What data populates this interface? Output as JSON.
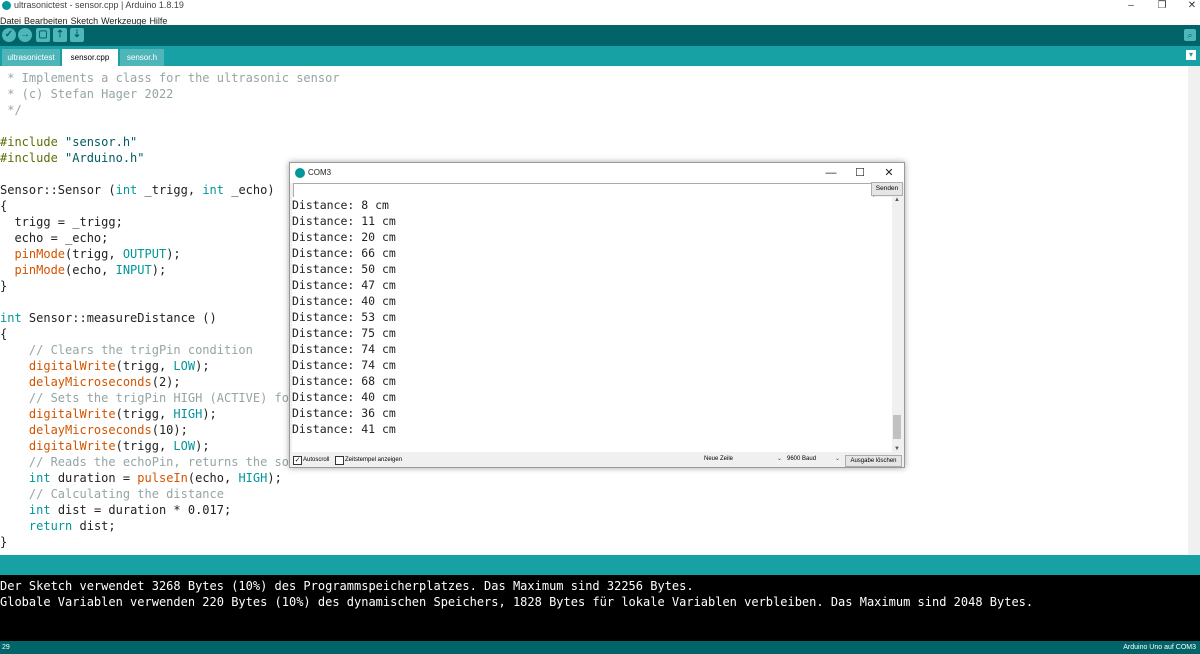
{
  "window": {
    "title": "ultrasonictest - sensor.cpp | Arduino 1.8.19",
    "minimize": "‒",
    "maximize": "❐",
    "close": "✕"
  },
  "menu": [
    "Datei",
    "Bearbeiten",
    "Sketch",
    "Werkzeuge",
    "Hilfe"
  ],
  "toolbar": {
    "verify": "✓",
    "upload": "→",
    "new": "▢",
    "open": "⇡",
    "save": "⇣",
    "serial_monitor": "⌕"
  },
  "tabs": [
    "ultrasonictest",
    "sensor.cpp",
    "sensor.h"
  ],
  "tab_menu": "▾",
  "editor": {
    "lines": [
      " * Implements a class for the ultrasonic sensor",
      " * (c) Stefan Hager 2022",
      " */",
      "",
      "#include \"sensor.h\"",
      "#include \"Arduino.h\"",
      "",
      "Sensor::Sensor (int _trigg, int _echo)",
      "{",
      "  trigg = _trigg;",
      "  echo = _echo;",
      "  pinMode(trigg, OUTPUT);",
      "  pinMode(echo, INPUT);",
      "}",
      "",
      "int Sensor::measureDistance ()",
      "{",
      "    // Clears the trigPin condition",
      "    digitalWrite(trigg, LOW);",
      "    delayMicroseconds(2);",
      "    // Sets the trigPin HIGH (ACTIVE) fo",
      "    digitalWrite(trigg, HIGH);",
      "    delayMicroseconds(10);",
      "    digitalWrite(trigg, LOW);",
      "    // Reads the echoPin, returns the so",
      "    int duration = pulseIn(echo, HIGH);",
      "    // Calculating the distance",
      "    int dist = duration * 0.017;",
      "    return dist;",
      "}"
    ]
  },
  "console": {
    "lines": [
      "Der Sketch verwendet 3268 Bytes (10%) des Programmspeicherplatzes. Das Maximum sind 32256 Bytes.",
      "Globale Variablen verwenden 220 Bytes (10%) des dynamischen Speichers, 1828 Bytes für lokale Variablen verbleiben. Das Maximum sind 2048 Bytes."
    ]
  },
  "footer": {
    "line_number": "29",
    "board": "Arduino Uno auf COM3"
  },
  "serial_monitor": {
    "title": "COM3",
    "minimize": "—",
    "maximize": "☐",
    "close": "✕",
    "input_value": "",
    "send_label": "Senden",
    "output": [
      "Distance: 8 cm",
      "Distance: 11 cm",
      "Distance: 20 cm",
      "Distance: 66 cm",
      "Distance: 50 cm",
      "Distance: 47 cm",
      "Distance: 40 cm",
      "Distance: 53 cm",
      "Distance: 75 cm",
      "Distance: 74 cm",
      "Distance: 74 cm",
      "Distance: 68 cm",
      "Distance: 40 cm",
      "Distance: 36 cm",
      "Distance: 41 cm"
    ],
    "autoscroll_label": "Autoscroll",
    "autoscroll_checked": true,
    "timestamp_label": "Zeitstempel anzeigen",
    "timestamp_checked": false,
    "line_ending": "Neue Zeile",
    "baud": "9600 Baud",
    "clear_label": "Ausgabe löschen",
    "check_mark": "✓",
    "chevron": "⌄",
    "scroll_up": "▲",
    "scroll_down": "▼"
  },
  "colors": {
    "toolbar": "#006468",
    "tabbar": "#17a1a5",
    "keyword": "#00979c",
    "function": "#d35400",
    "string": "#005c5f",
    "comment": "#95a5a6",
    "console_bg": "#000000"
  }
}
